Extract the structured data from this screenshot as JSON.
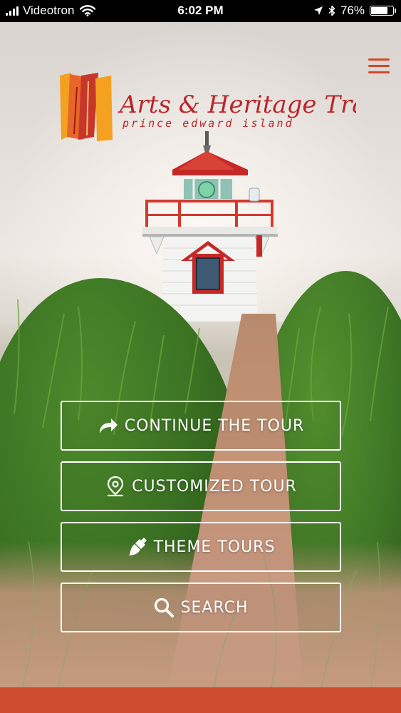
{
  "status_bar": {
    "carrier": "Videotron",
    "time": "6:02 PM",
    "battery": "76%",
    "battery_level": 0.76
  },
  "header": {
    "logo_title": "Arts & Heritage Trail",
    "logo_subtitle": "prince edward island",
    "menu_icon": "hamburger-menu-icon"
  },
  "actions": [
    {
      "label": "CONTINUE THE TOUR",
      "icon": "share-forward-icon"
    },
    {
      "label": "CUSTOMIZED TOUR",
      "icon": "map-pin-icon"
    },
    {
      "label": "THEME TOURS",
      "icon": "paintbrush-icon"
    },
    {
      "label": "SEARCH",
      "icon": "search-icon"
    }
  ],
  "colors": {
    "brand_red": "#cf4b2f",
    "logo_orange": "#e8652a",
    "logo_yellow": "#f3a11f",
    "logo_text": "#b9262a"
  }
}
